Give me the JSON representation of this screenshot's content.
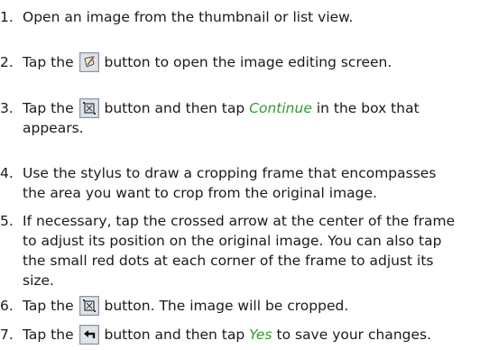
{
  "steps": [
    {
      "number": "1.",
      "text": "Open an image from the thumbnail or list view."
    },
    {
      "number": "2.",
      "before": "Tap the",
      "icon": "edit-button-icon",
      "after": "button to open the image editing screen."
    },
    {
      "number": "3.",
      "before": "Tap the",
      "icon": "crop-button-icon",
      "after": "button and then tap",
      "link": "Continue",
      "after2": "in the box that",
      "line2": "appears."
    },
    {
      "number": "4.",
      "line1": "Use the stylus to draw a cropping frame that encompasses",
      "line2": "the area you want to crop from the original image."
    },
    {
      "number": "5.",
      "line1": "If necessary, tap the crossed arrow at the center of the frame",
      "line2": "to adjust its position on the original image. You can also tap",
      "line3": "the small red dots at each corner of the frame to adjust its",
      "line4": "size."
    },
    {
      "number": "6.",
      "before": "Tap the",
      "icon": "crop-button-icon",
      "after": "button. The image will be cropped."
    },
    {
      "number": "7.",
      "before": "Tap the",
      "icon": "back-arrow-button-icon",
      "after": "button and then tap",
      "link": "Yes",
      "after2": "to save your changes."
    }
  ],
  "colors": {
    "text": "#1a1a1a",
    "emphasis": "#2f9a2f"
  }
}
